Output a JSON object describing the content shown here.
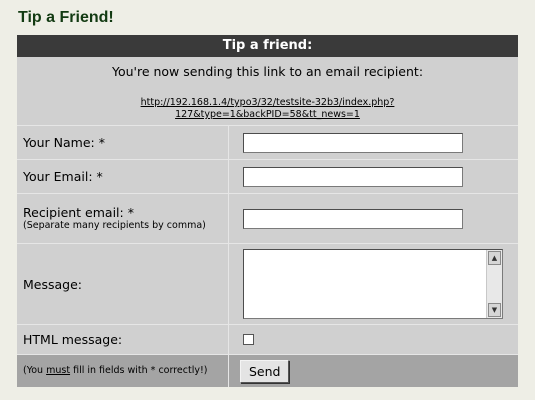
{
  "page": {
    "title": "Tip a Friend!"
  },
  "form": {
    "header": "Tip a friend:",
    "intro": "You're now sending this link to an email recipient:",
    "link_line1": "http://192.168.1.4/typo3/32/testsite-32b3/index.php?",
    "link_line2": "127&type=1&backPID=58&tt_news=1",
    "fields": {
      "your_name": {
        "label": "Your Name:  *",
        "value": ""
      },
      "your_email": {
        "label": "Your Email:  *",
        "value": ""
      },
      "recipient_email": {
        "label": "Recipient email:  *",
        "note": "(Separate many recipients by comma)",
        "value": ""
      },
      "message": {
        "label": "Message:",
        "value": ""
      },
      "html_message": {
        "label": "HTML message:",
        "checked": false
      }
    },
    "footer_note_prefix": "(You ",
    "footer_note_emph": "must",
    "footer_note_suffix": " fill in fields with * correctly!)",
    "send_label": "Send"
  },
  "colors": {
    "page_background": "#eeeee6",
    "title_color": "#123a12",
    "header_background": "#3a3a3a",
    "form_background": "#d0d0d0",
    "footer_background": "#a4a4a4"
  }
}
